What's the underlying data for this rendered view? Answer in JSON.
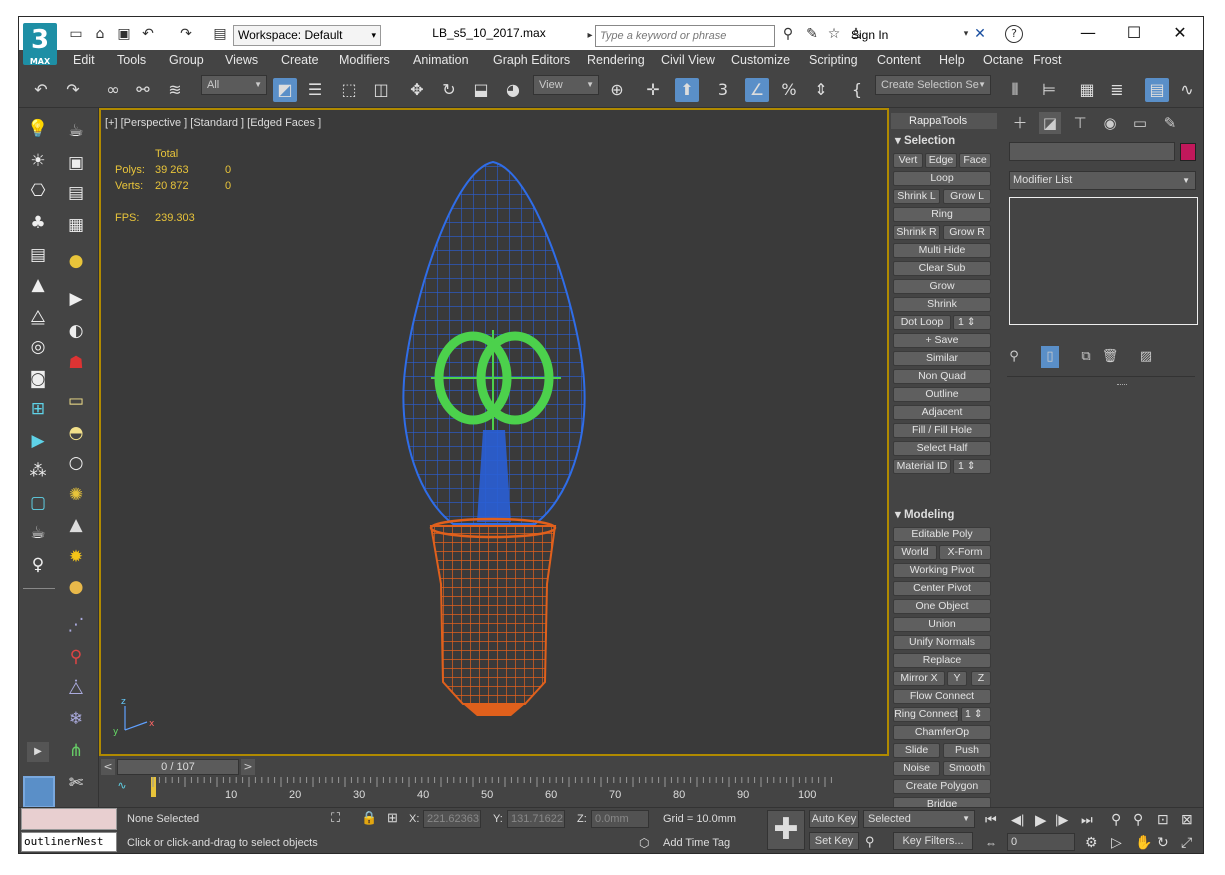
{
  "app": {
    "logo_text": "3",
    "logo_sub": "MAX"
  },
  "titlebar": {
    "workspace": "Workspace: Default",
    "filename": "LB_s5_10_2017.max",
    "search_placeholder": "Type a keyword or phrase",
    "signin": "Sign In",
    "help": "?"
  },
  "menu": [
    "Edit",
    "Tools",
    "Group",
    "Views",
    "Create",
    "Modifiers",
    "Animation",
    "Graph Editors",
    "Rendering",
    "Civil View",
    "Customize",
    "Scripting",
    "Content",
    "Help",
    "Octane",
    "Frost"
  ],
  "toolbar": {
    "filter": "All",
    "refcoord": "View",
    "selset": "Create Selection Se"
  },
  "viewport": {
    "label": "[+] [Perspective ] [Standard ] [Edged Faces ]",
    "stats_header": "Total",
    "polys_label": "Polys:",
    "polys_total": "39 263",
    "polys_sel": "0",
    "verts_label": "Verts:",
    "verts_total": "20 872",
    "verts_sel": "0",
    "fps_label": "FPS:",
    "fps": "239.303"
  },
  "rappa": {
    "title": "RappaTools",
    "selection_title": "Selection",
    "modeling_title": "Modeling",
    "sel": {
      "vert": "Vert",
      "edge": "Edge",
      "face": "Face",
      "loop": "Loop",
      "shrinkl": "Shrink L",
      "growl": "Grow L",
      "ring": "Ring",
      "shrinkr": "Shrink R",
      "growr": "Grow R",
      "multihide": "Multi Hide",
      "clearsub": "Clear Sub",
      "grow": "Grow",
      "shrink": "Shrink",
      "dotloop": "Dot Loop",
      "dotloop_val": "1",
      "save": "+ Save",
      "similar": "Similar",
      "nonquad": "Non Quad",
      "outline": "Outline",
      "adjacent": "Adjacent",
      "fillhole": "Fill / Fill Hole",
      "selecthalf": "Select Half",
      "matid": "Material ID",
      "matid_val": "1"
    },
    "mod": {
      "editpoly": "Editable Poly",
      "world": "World",
      "xform": "X-Form",
      "workpivot": "Working Pivot",
      "centerpivot": "Center Pivot",
      "oneobject": "One Object",
      "union": "Union",
      "unifynormals": "Unify Normals",
      "replace": "Replace",
      "mirrorx": "Mirror X",
      "y": "Y",
      "z": "Z",
      "flowconnect": "Flow Connect",
      "ringconnect": "Ring Connect",
      "ringconnect_val": "1",
      "chamferop": "ChamferOp",
      "slide": "Slide",
      "push": "Push",
      "noise": "Noise",
      "smooth": "Smooth",
      "createpolygon": "Create Polygon",
      "bridge": "Bridge"
    }
  },
  "cmdpanel": {
    "modifier_list": "Modifier List"
  },
  "timeline": {
    "frame": "0 / 107",
    "ticks": [
      "10",
      "20",
      "30",
      "40",
      "50",
      "60",
      "70",
      "80",
      "90",
      "100"
    ]
  },
  "status": {
    "maxscript": "outlinerNest",
    "selection": "None Selected",
    "prompt": "Click or click-and-drag to select objects",
    "x_label": "X:",
    "x_val": "221.62363",
    "y_label": "Y:",
    "y_val": "131.71622",
    "z_label": "Z:",
    "z_val": "0.0mm",
    "grid": "Grid = 10.0mm",
    "addtimetag": "Add Time Tag",
    "autokey": "Auto Key",
    "setkey": "Set Key",
    "keymode": "Selected",
    "keyfilters": "Key Filters...",
    "frame_field": "0"
  },
  "colors": {
    "bulb_glass": "#2a5fd6",
    "filament": "#4cd14c",
    "base": "#e0601c",
    "accent": "#5a8fc8"
  }
}
